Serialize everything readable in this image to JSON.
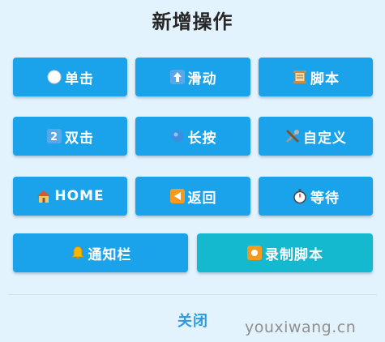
{
  "dialog": {
    "title": "新增操作",
    "close_label": "关闭"
  },
  "buttons": {
    "click": {
      "label": "单击",
      "icon": "white-circle-icon"
    },
    "swipe": {
      "label": "滑动",
      "icon": "up-arrow-icon"
    },
    "script": {
      "label": "脚本",
      "icon": "scroll-icon"
    },
    "double_click": {
      "label": "双击",
      "icon": "keycap-2-icon"
    },
    "long_press": {
      "label": "长按",
      "icon": "blue-circle-icon"
    },
    "custom": {
      "label": "自定义",
      "icon": "tools-icon"
    },
    "home": {
      "label": "HOME",
      "icon": "house-icon"
    },
    "back": {
      "label": "返回",
      "icon": "back-triangle-icon"
    },
    "wait": {
      "label": "等待",
      "icon": "stopwatch-icon"
    },
    "notification": {
      "label": "通知栏",
      "icon": "bell-icon"
    },
    "record_script": {
      "label": "录制脚本",
      "icon": "record-button-icon"
    }
  },
  "colors": {
    "primary_button": "#1aa3ea",
    "record_button": "#15b9cf",
    "close_text": "#2c9ae0",
    "background": "#e3f3fd"
  },
  "watermark": "youxiwang.cn"
}
